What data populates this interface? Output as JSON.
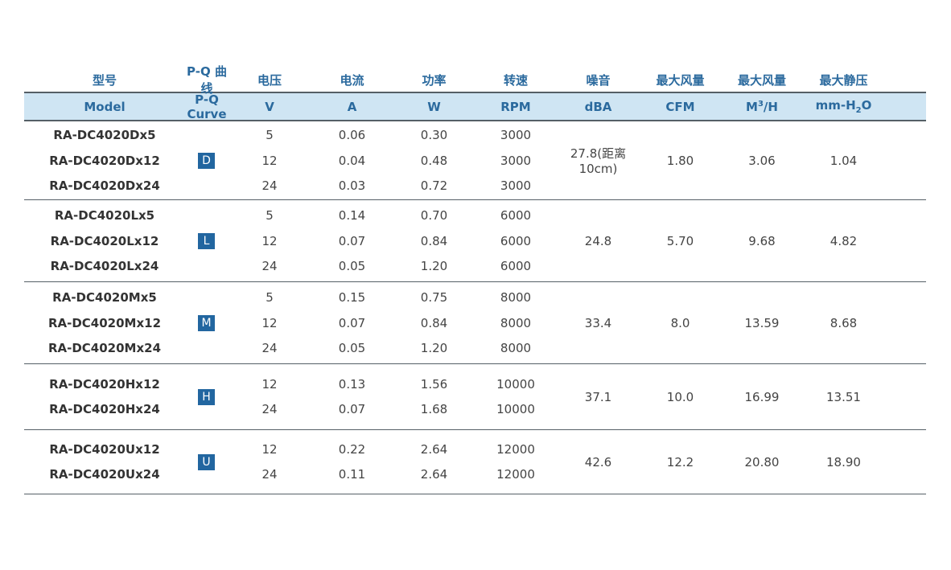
{
  "header_cn": [
    "型号",
    "P-Q 曲线",
    "电压",
    "电流",
    "功率",
    "转速",
    "噪音",
    "最大风量",
    "最大风量",
    "最大静压"
  ],
  "header_en": {
    "model": "Model",
    "pq": "P-Q Curve",
    "voltage": "V",
    "current": "A",
    "power": "W",
    "speed": "RPM",
    "noise": "dBA",
    "cfm": "CFM",
    "m3h_prefix": "M",
    "m3h_sup": "3",
    "m3h_suffix": "/H",
    "mmh2o_prefix": "mm-H",
    "mmh2o_sub": "2",
    "mmh2o_suffix": "O"
  },
  "groups": [
    {
      "curve": "D",
      "noise": "27.8(距离10cm)",
      "cfm": "1.80",
      "m3h": "3.06",
      "pressure": "1.04",
      "rows": [
        {
          "model": "RA-DC4020Dx5",
          "v": "5",
          "a": "0.06",
          "w": "0.30",
          "rpm": "3000"
        },
        {
          "model": "RA-DC4020Dx12",
          "v": "12",
          "a": "0.04",
          "w": "0.48",
          "rpm": "3000"
        },
        {
          "model": "RA-DC4020Dx24",
          "v": "24",
          "a": "0.03",
          "w": "0.72",
          "rpm": "3000"
        }
      ]
    },
    {
      "curve": "L",
      "noise": "24.8",
      "cfm": "5.70",
      "m3h": "9.68",
      "pressure": "4.82",
      "rows": [
        {
          "model": "RA-DC4020Lx5",
          "v": "5",
          "a": "0.14",
          "w": "0.70",
          "rpm": "6000"
        },
        {
          "model": "RA-DC4020Lx12",
          "v": "12",
          "a": "0.07",
          "w": "0.84",
          "rpm": "6000"
        },
        {
          "model": "RA-DC4020Lx24",
          "v": "24",
          "a": "0.05",
          "w": "1.20",
          "rpm": "6000"
        }
      ]
    },
    {
      "curve": "M",
      "noise": "33.4",
      "cfm": "8.0",
      "m3h": "13.59",
      "pressure": "8.68",
      "rows": [
        {
          "model": "RA-DC4020Mx5",
          "v": "5",
          "a": "0.15",
          "w": "0.75",
          "rpm": "8000"
        },
        {
          "model": "RA-DC4020Mx12",
          "v": "12",
          "a": "0.07",
          "w": "0.84",
          "rpm": "8000"
        },
        {
          "model": "RA-DC4020Mx24",
          "v": "24",
          "a": "0.05",
          "w": "1.20",
          "rpm": "8000"
        }
      ]
    },
    {
      "curve": "H",
      "noise": "37.1",
      "cfm": "10.0",
      "m3h": "16.99",
      "pressure": "13.51",
      "rows": [
        {
          "model": "RA-DC4020Hx12",
          "v": "12",
          "a": "0.13",
          "w": "1.56",
          "rpm": "10000"
        },
        {
          "model": "RA-DC4020Hx24",
          "v": "24",
          "a": "0.07",
          "w": "1.68",
          "rpm": "10000"
        }
      ]
    },
    {
      "curve": "U",
      "noise": "42.6",
      "cfm": "12.2",
      "m3h": "20.80",
      "pressure": "18.90",
      "rows": [
        {
          "model": "RA-DC4020Ux12",
          "v": "12",
          "a": "0.22",
          "w": "2.64",
          "rpm": "12000"
        },
        {
          "model": "RA-DC4020Ux24",
          "v": "24",
          "a": "0.11",
          "w": "2.64",
          "rpm": "12000"
        }
      ]
    }
  ]
}
